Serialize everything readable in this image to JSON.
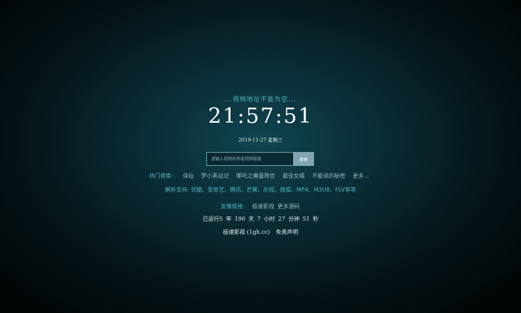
{
  "status_text": "...视频地址不能为空...",
  "clock": "21:57:51",
  "date": {
    "date_text": "2019-11-27",
    "weekday": "星期三"
  },
  "search": {
    "placeholder": "请输入视频名称或视频链接",
    "value": "",
    "button_label": "搜索"
  },
  "hot_search": {
    "label": "热门搜索:",
    "items": [
      "诛仙",
      "罗小黑战记",
      "哪吒之魔童降世",
      "最佳女婿",
      "不能说的秘密",
      "更多..."
    ]
  },
  "support": {
    "text": "解析支持: 优酷、爱奇艺、腾讯、芒果、乐视、搜狐、MP4、M3U8、FLV等等"
  },
  "friends": {
    "label": "友情链接:",
    "links": [
      "极速影视",
      "更多源码"
    ]
  },
  "uptime": {
    "prefix": "已运行5",
    "year_unit": "年",
    "days": "190",
    "day_unit": "天",
    "hours": "7",
    "hour_unit": "小时",
    "minutes": "27",
    "minute_unit": "分钟",
    "seconds": "51",
    "second_unit": "秒"
  },
  "footer": {
    "site_link": "极速影视 (1gh.cc)",
    "disclaimer_link": "免责声明"
  },
  "colors": {
    "accent": "#4fb3c4",
    "background": "#0a2c35",
    "button": "#7fa6b2"
  }
}
